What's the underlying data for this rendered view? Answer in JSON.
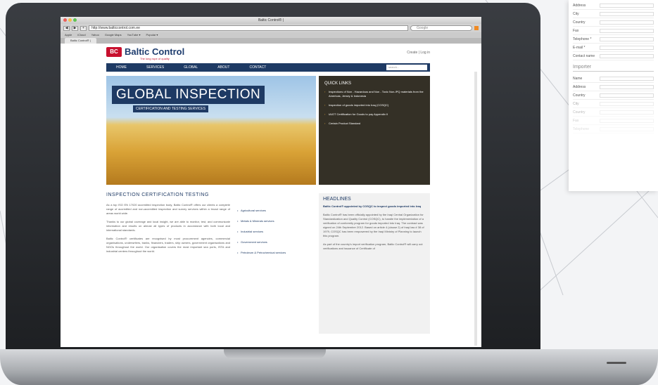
{
  "side_form": {
    "rows": [
      "Address",
      "City",
      "Country",
      "Fax",
      "Telephone *",
      "E-mail *",
      "Contact name"
    ],
    "section_title": "Importer",
    "rows2": [
      "Name",
      "Address",
      "Country",
      "City",
      "Country",
      "Fax",
      "Telephone"
    ]
  },
  "browser": {
    "window_title": "Baltic Control® |",
    "url": "http://www.balticcontrol.com.ee",
    "search_placeholder": "Google",
    "bookmarks": [
      "Apple",
      "iCloud",
      "Yahoo",
      "Google Maps",
      "YouTube ▾",
      "Popular ▾"
    ],
    "tab_label": "Baltic Control® |",
    "buttons": [
      "◀",
      "▶",
      "+"
    ]
  },
  "site": {
    "logo_mark": "BC",
    "logo_name": "Baltic Control",
    "logo_tagline": "The long rope of quality",
    "login": "Create | Log in",
    "nav": [
      "HOME",
      "SERVICES",
      "GLOBAL",
      "ABOUT",
      "CONTACT"
    ],
    "nav_search_placeholder": "search...",
    "hero_title": "GLOBAL INSPECTION",
    "hero_subtitle": "CERTIFICATION AND TESTING SERVICES",
    "quick_links_title": "QUICK LINKS",
    "quick_links": [
      "Inspections of Non - Hazardous and Non - Toxic Non-IPQ materials from the Americas, Jersey & Indonesia",
      "Inspection of goods imported into Iraq (COSQC)",
      "IAIOT Certification for Goods to pay Appendix II",
      "Certain Product Standard"
    ],
    "section_heading": "INSPECTION   CERTIFICATION   TESTING",
    "paragraphs": [
      "As a top ISO EN 17020 accredited inspection body, Baltic Control® offers our clients a complete range of accredited and non-accredited inspection and survey services within a broad range of areas world wide.",
      "Thanks to our global coverage and local insight, we are able to monitor, test, and communicate information and results on almost all types of products in accordance with both local and international standards.",
      "Baltic Control® certificates are recognised by most procurement agencies, commercial organisations, underwriters, banks, financiers, traders, ship owners, government organisations and NGOs throughout the world. Our organisation covers the most important sea ports, ISTA and industrial centers throughout the world."
    ],
    "services": [
      "Agricultural services",
      "Metals & Minerals services",
      "Industrial services",
      "Government services",
      "Petroleum & Petrochemical services"
    ],
    "headlines_title": "HEADLINES",
    "headline": "Baltic Control® appointed by COSQC to inspect goods imported into Iraq",
    "headline_body": [
      "Baltic Control® has been officially appointed by the Iraqi Central Organization for Standardization and Quality Control (COSQC), to handle the implementation of a verification of conformity program for goods imported into Iraq. The contract was signed on 24th September 2012. Based on article 4 (clause 2) of Iraqi law # 38 of 1979, COSQC has been empowered by the Iraqi Ministry of Planning to launch this program.",
      "As part of the country's import verification program, Baltic Control® will carry out verifications and issuance of Certificate of"
    ]
  }
}
